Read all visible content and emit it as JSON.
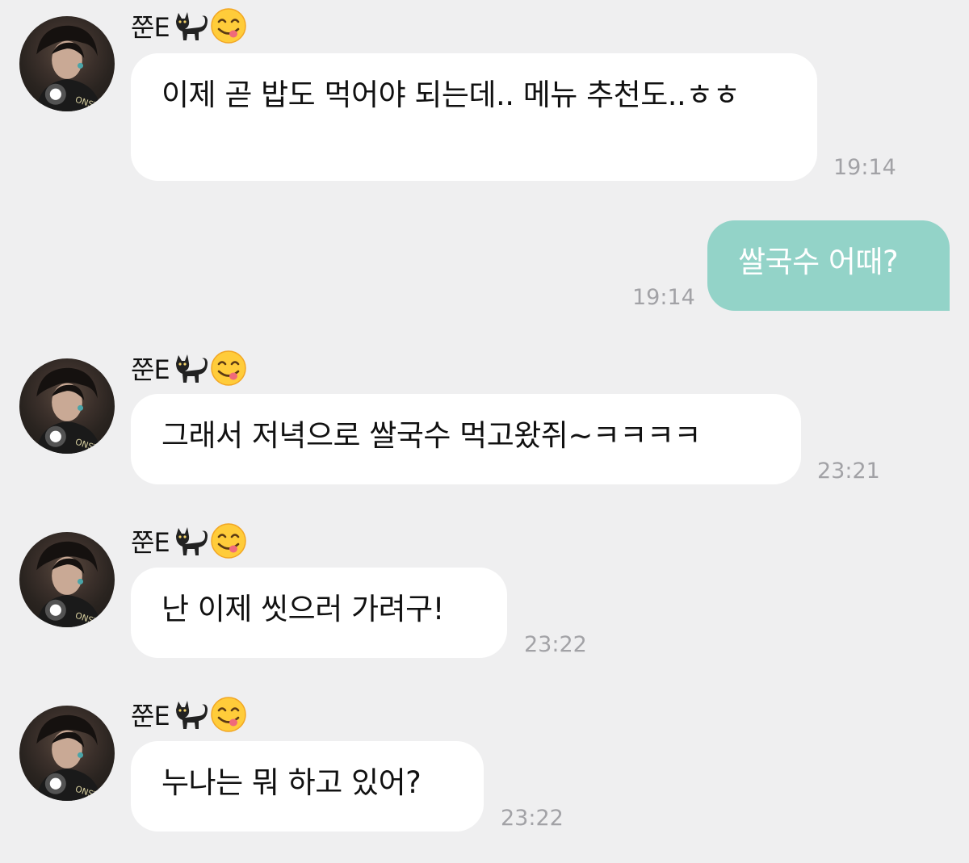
{
  "sender": {
    "name": "쭌E",
    "icons": [
      "black-cat-icon",
      "yummy-face-icon"
    ]
  },
  "colors": {
    "background": "#efeff0",
    "incoming_bubble": "#ffffff",
    "outgoing_bubble": "#93d3c8",
    "timestamp": "#a2a2a6"
  },
  "messages": [
    {
      "from": "쭌E",
      "text": "이제 곧 밥도 먹어야 되는데.. 메뉴 추천도..ㅎㅎ",
      "time": "19:14"
    },
    {
      "from": "me",
      "text": "쌀국수 어때?",
      "time": "19:14"
    },
    {
      "from": "쭌E",
      "text": "그래서 저녁으로 쌀국수 먹고왔쥐~ㅋㅋㅋㅋ",
      "time": "23:21"
    },
    {
      "from": "쭌E",
      "text": "난 이제 씻으러 가려구!",
      "time": "23:22"
    },
    {
      "from": "쭌E",
      "text": "누나는 뭐 하고 있어?",
      "time": "23:22"
    }
  ]
}
